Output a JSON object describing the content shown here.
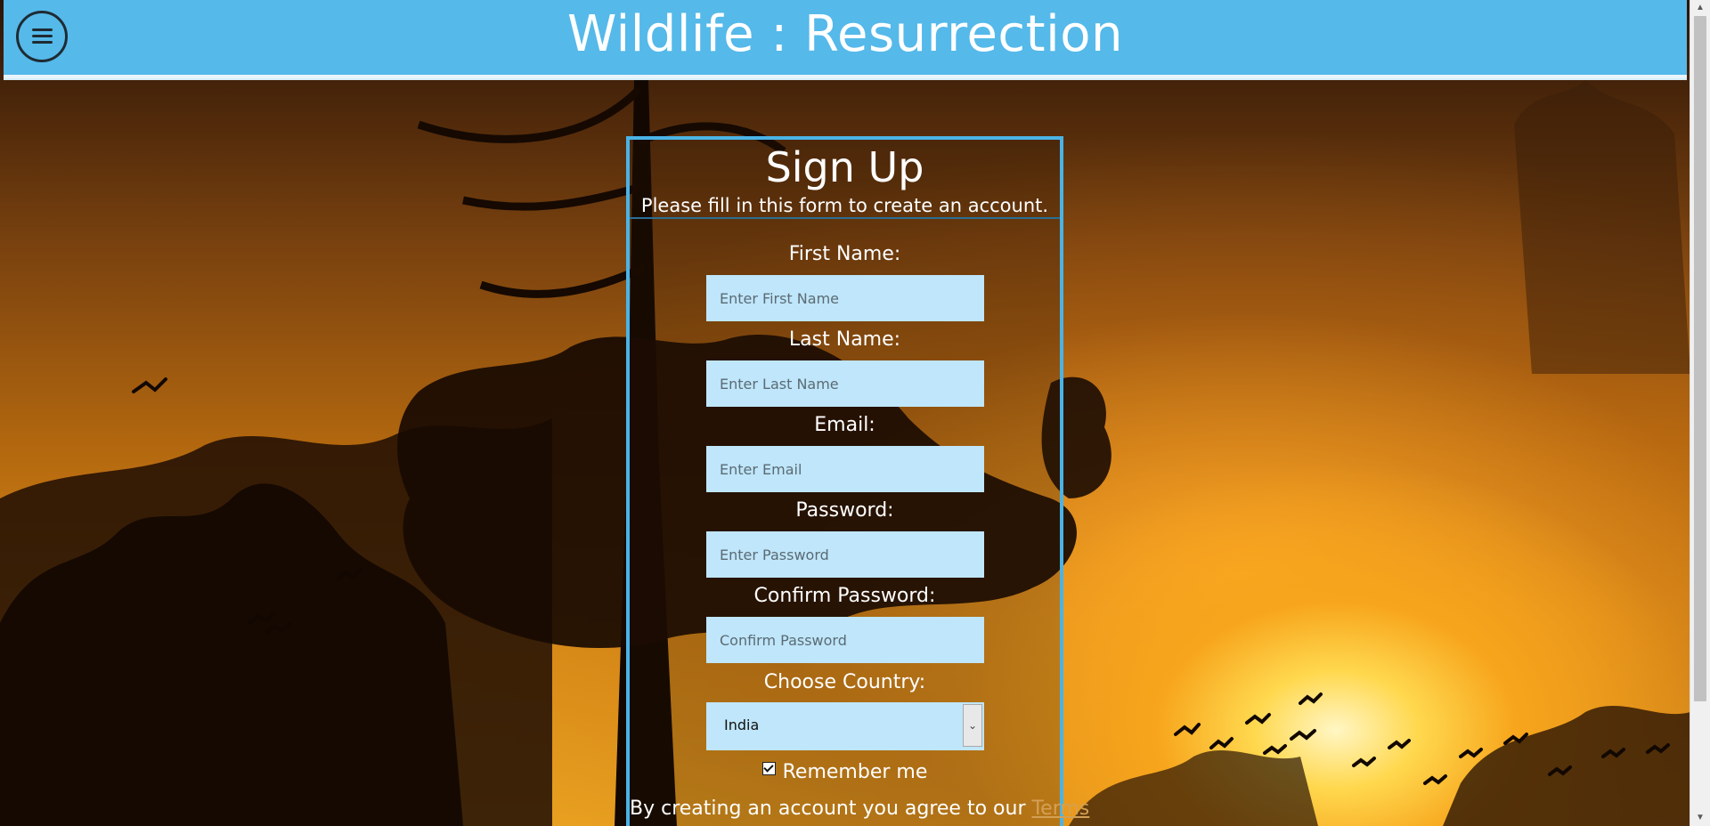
{
  "header": {
    "title": "Wildlife : Resurrection",
    "menu_icon": "hamburger-icon",
    "background_color": "#55b9ea"
  },
  "form": {
    "title": "Sign Up",
    "subtitle": "Please fill in this form to create an account.",
    "border_color": "#4ab3e6",
    "input_color": "#bfe6fa",
    "fields": [
      {
        "label": "First Name:",
        "placeholder": "Enter First Name",
        "value": ""
      },
      {
        "label": "Last Name:",
        "placeholder": "Enter Last Name",
        "value": ""
      },
      {
        "label": "Email:",
        "placeholder": "Enter Email",
        "value": ""
      },
      {
        "label": "Password:",
        "placeholder": "Enter Password",
        "value": ""
      },
      {
        "label": "Confirm Password:",
        "placeholder": "Confirm Password",
        "value": ""
      }
    ],
    "country": {
      "label": "Choose Country:",
      "selected": "India"
    },
    "remember_me": {
      "label": "Remember me",
      "checked": true
    },
    "terms": {
      "prefix": "By creating an account you agree to our ",
      "link": "Terms"
    }
  }
}
